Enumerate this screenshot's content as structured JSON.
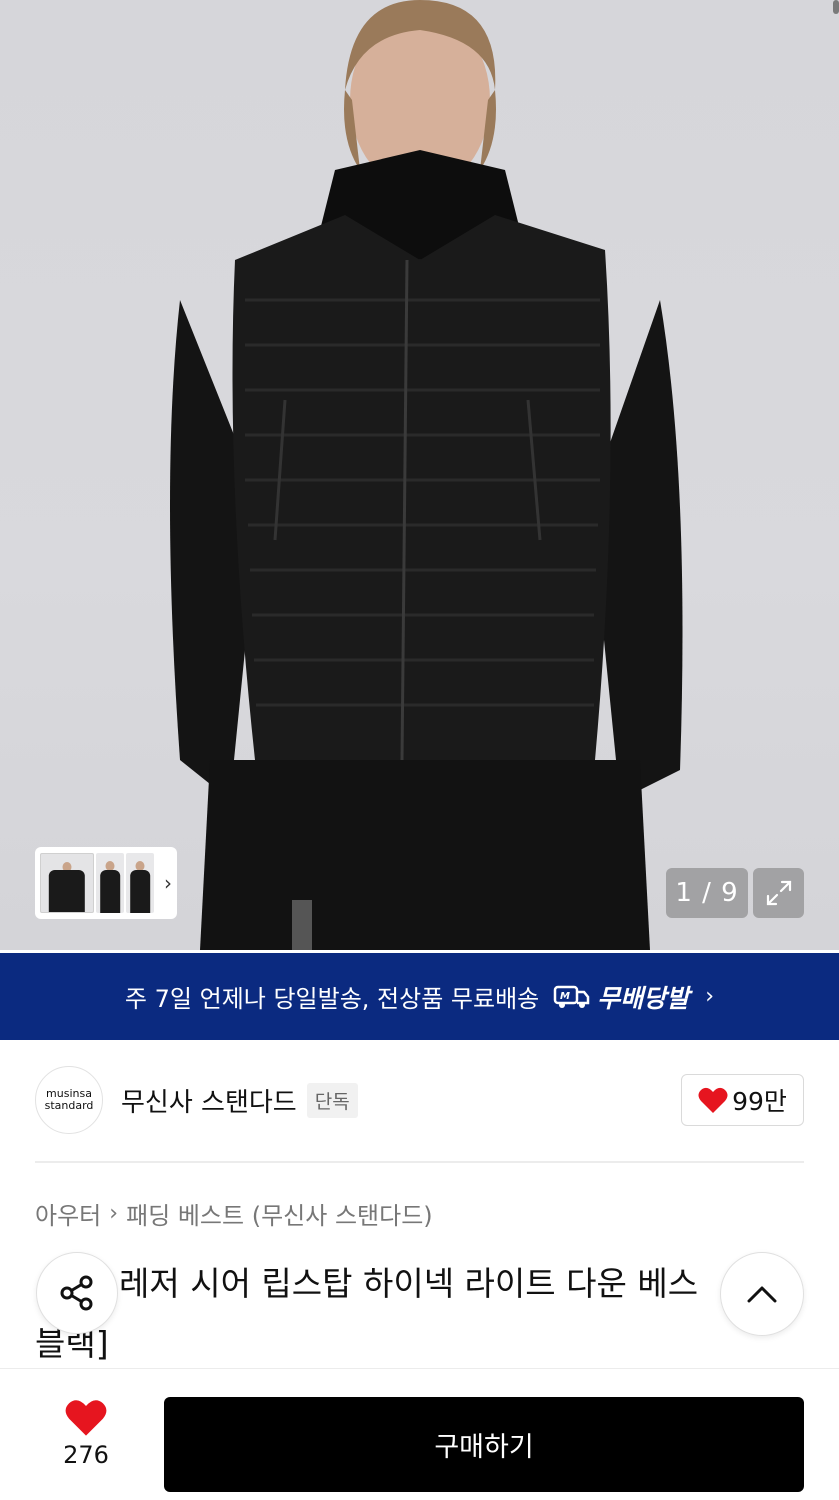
{
  "gallery": {
    "counter": "1 / 9",
    "thumbnail_count": 3
  },
  "banner": {
    "text": "주 7일 언제나 당일발송, 전상품 무료배송",
    "logo_text": "무배당발",
    "arrow": "›"
  },
  "brand": {
    "logo_line1": "musinsa",
    "logo_line2": "standard",
    "name": "무신사 스탠다드",
    "badge": "단독",
    "likes": "99만"
  },
  "breadcrumb": {
    "category": "아우터",
    "separator": "›",
    "subcategory": "패딩 베스트 (무신사 스탠다드)"
  },
  "product": {
    "title": "레저 시어 립스탑 하이넥 라이트 다운 베스",
    "title_line2": "블랙]"
  },
  "bottom_bar": {
    "wish_count": "276",
    "buy_label": "구매하기"
  },
  "colors": {
    "banner_bg": "#0b2a80",
    "heart": "#e6151f",
    "buy_bg": "#000000"
  },
  "icons": [
    "chevron-right-icon",
    "expand-icon",
    "truck-icon",
    "heart-icon",
    "share-icon",
    "chevron-up-icon"
  ]
}
